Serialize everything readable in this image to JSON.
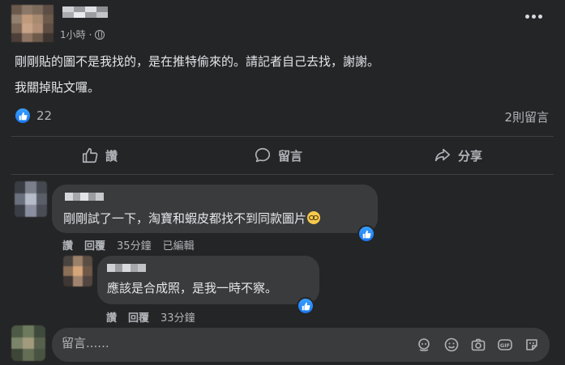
{
  "post": {
    "time": "1小時",
    "dot": "·",
    "line1": "剛剛貼的圖不是我找的，是在推特偷來的。請記者自己去找，謝謝。",
    "line2": "我關掉貼文囉。",
    "reaction_count": "22",
    "comment_count": "2則留言"
  },
  "actions": {
    "like": "讚",
    "comment": "留言",
    "share": "分享"
  },
  "comments": [
    {
      "text": "剛剛試了一下，淘寶和蝦皮都找不到同款圖片",
      "like": "讚",
      "reply": "回覆",
      "time": "35分鐘",
      "edited": "已編輯"
    },
    {
      "text": "應該是合成照，是我一時不察。",
      "like": "讚",
      "reply": "回覆",
      "time": "33分鐘"
    }
  ],
  "composer": {
    "placeholder": "留言......"
  },
  "colors": {
    "background": "#242526",
    "bubble": "#3a3b3c",
    "like_blue": "#1877f2",
    "text": "#e4e6eb",
    "secondary_text": "#b0b3b8"
  }
}
